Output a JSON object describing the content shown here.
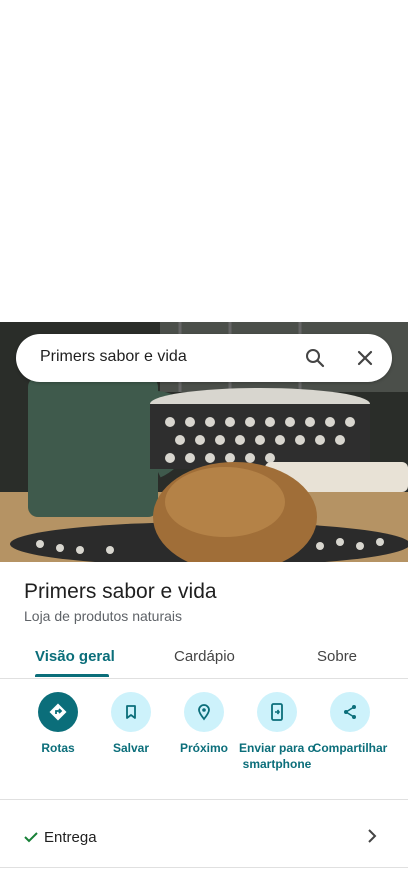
{
  "search": {
    "query": "Primers sabor e vida"
  },
  "place": {
    "name": "Primers sabor e vida",
    "category": "Loja de produtos naturais"
  },
  "tabs": [
    {
      "label": "Visão geral",
      "active": true
    },
    {
      "label": "Cardápio",
      "active": false
    },
    {
      "label": "Sobre",
      "active": false
    }
  ],
  "actions": [
    {
      "label": "Rotas",
      "icon": "directions-icon"
    },
    {
      "label": "Salvar",
      "icon": "bookmark-icon"
    },
    {
      "label": "Próximo",
      "icon": "nearby-icon"
    },
    {
      "label": "Enviar para o smartphone",
      "icon": "send-to-phone-icon"
    },
    {
      "label": "Compartilhar",
      "icon": "share-icon"
    }
  ],
  "delivery": {
    "label": "Entrega"
  },
  "colors": {
    "accent": "#0b6e7a",
    "action_bg": "#cdf2fb"
  }
}
